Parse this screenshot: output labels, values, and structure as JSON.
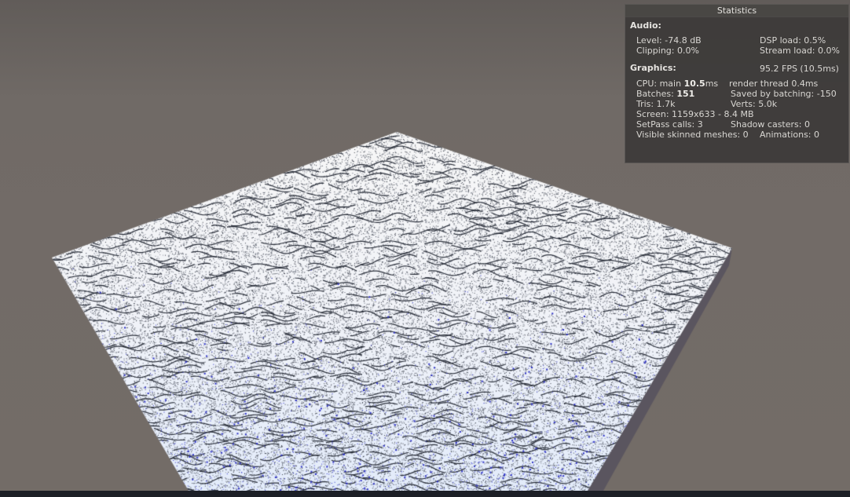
{
  "stats": {
    "title": "Statistics",
    "audio": {
      "heading": "Audio:",
      "level": "Level: -74.8 dB",
      "clipping": "Clipping: 0.0%",
      "dsp_load": "DSP load: 0.5%",
      "stream_load": "Stream load: 0.0%"
    },
    "graphics": {
      "heading": "Graphics:",
      "fps": "95.2 FPS (10.5ms)",
      "cpu_prefix": "CPU: main ",
      "cpu_main_value": "10.5",
      "cpu_suffix": "ms",
      "render_thread": "render thread 0.4ms",
      "batches_prefix": "Batches: ",
      "batches_value": "151",
      "saved_by_batching": "Saved by batching: -150",
      "tris": "Tris: 1.7k",
      "verts": "Verts: 5.0k",
      "screen": "Screen: 1159x633 - 8.4 MB",
      "setpass_calls": "SetPass calls: 3",
      "shadow_casters": "Shadow casters: 0",
      "visible_skinned_meshes": "Visible skinned meshes: 0",
      "animations": "Animations: 0"
    }
  },
  "scene": {
    "object": "noise-terrain-plane",
    "surface_color": "#eef2fb",
    "noise_dark_color": "#2a2f3a",
    "noise_blue_color": "#2b2fc8",
    "side_color": "#5a555f",
    "background_color": "#726b67",
    "bottom_bar_color": "#1c1f26"
  }
}
